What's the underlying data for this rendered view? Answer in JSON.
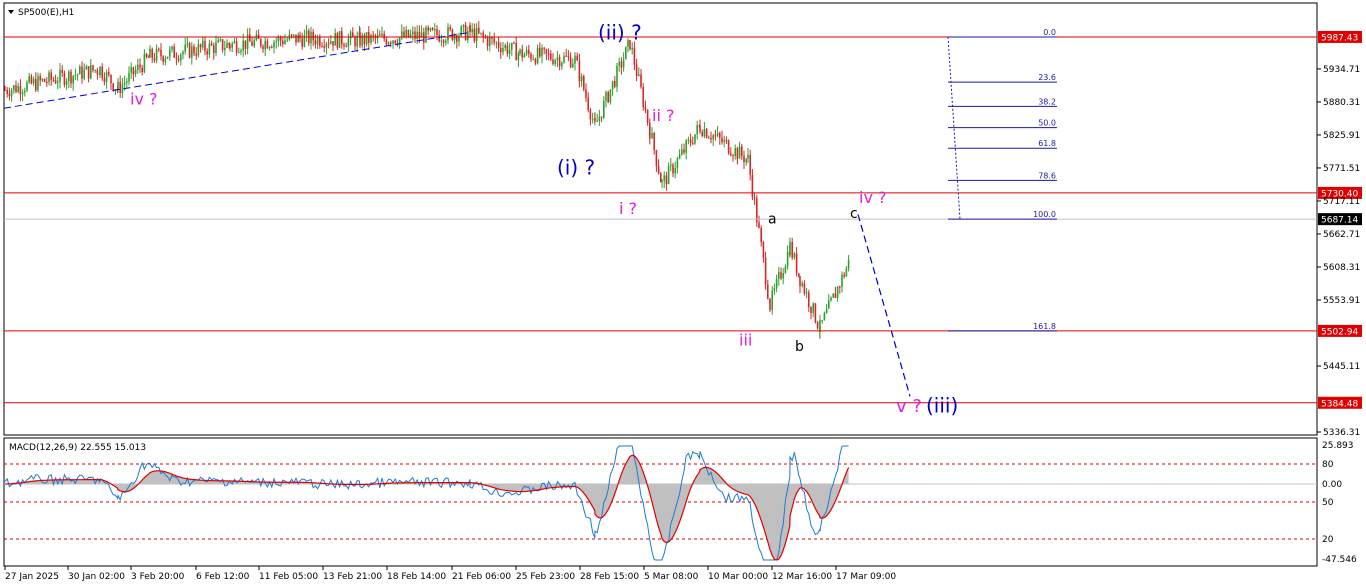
{
  "window": {
    "symbol_label": "SP500(E),H1",
    "symbol_menu_icon": "triangle-down-icon"
  },
  "price_scale": {
    "ticks": [
      "5934.71",
      "5880.31",
      "5825.91",
      "5771.51",
      "5717.11",
      "5662.71",
      "5608.31",
      "5553.91",
      "5445.11",
      "5336.31"
    ],
    "min": 5336.31,
    "max": 5989
  },
  "time_axis": {
    "labels": [
      "27 Jan 2025",
      "30 Jan 02:00",
      "3 Feb 20:00",
      "6 Feb 12:00",
      "11 Feb 05:00",
      "13 Feb 21:00",
      "18 Feb 14:00",
      "21 Feb 06:00",
      "25 Feb 23:00",
      "28 Feb 15:00",
      "5 Mar 08:00",
      "10 Mar 00:00",
      "12 Mar 16:00",
      "17 Mar 09:00"
    ]
  },
  "colors": {
    "bull_candle": "#2ca02c",
    "bear_candle": "#d62728",
    "hline": "#e00000",
    "blue_label": "#0000cc",
    "magenta_label": "#e020e0",
    "black_label": "#000000",
    "fib": "#1a1aa8",
    "macd_hist": "#c0c0c0",
    "macd_signal": "#e00000",
    "macd_line": "#1e7ad6",
    "price_box": "#e00000"
  },
  "chart_data": [
    {
      "type": "candlestick",
      "title": "SP500(E),H1",
      "ylim": [
        5336.31,
        5989
      ],
      "path_points": [
        {
          "x": "27 Jan 2025",
          "y": 5900
        },
        {
          "x": "30 Jan 02:00",
          "y": 5935
        },
        {
          "x": "iv ? low",
          "y": 5902
        },
        {
          "x": "3 Feb 20:00",
          "y": 5955
        },
        {
          "x": "6 Feb 12:00",
          "y": 5975
        },
        {
          "x": "11 Feb 05:00",
          "y": 5985
        },
        {
          "x": "13 Feb 21:00",
          "y": 5982
        },
        {
          "x": "18 Feb 14:00",
          "y": 5995
        },
        {
          "x": "21 Feb 06:00",
          "y": 5960
        },
        {
          "x": "25 Feb 23:00",
          "y": 5950
        },
        {
          "x": "(i) low",
          "y": 5840
        },
        {
          "x": "(ii) high",
          "y": 5978
        },
        {
          "x": "i low",
          "y": 5745
        },
        {
          "x": "ii high",
          "y": 5840
        },
        {
          "x": "5 Mar 08:00",
          "y": 5785
        },
        {
          "x": "iii low",
          "y": 5545
        },
        {
          "x": "a high",
          "y": 5642
        },
        {
          "x": "12 Mar 16:00",
          "y": 5590
        },
        {
          "x": "b low",
          "y": 5507
        },
        {
          "x": "17 Mar 09:00",
          "y": 5620
        },
        {
          "x": "c high",
          "y": 5700
        }
      ],
      "horizontal_levels": [
        {
          "price": 5987.43,
          "label": "5987.43"
        },
        {
          "price": 5730.4,
          "label": "5730.40"
        },
        {
          "price": 5502.94,
          "label": "5502.94"
        },
        {
          "price": 5384.48,
          "label": "5384.48"
        }
      ],
      "current_price": {
        "price": 5687.14,
        "label": "5687.14"
      },
      "fibonacci": [
        {
          "level": "0.0",
          "price": 5987.43
        },
        {
          "level": "23.6",
          "price": 5913
        },
        {
          "level": "38.2",
          "price": 5873
        },
        {
          "level": "50.0",
          "price": 5838
        },
        {
          "level": "61.8",
          "price": 5804
        },
        {
          "level": "78.6",
          "price": 5751
        },
        {
          "level": "100.0",
          "price": 5687.14
        },
        {
          "level": "161.8",
          "price": 5502.94
        }
      ],
      "wave_labels": [
        {
          "text": "iv ?",
          "color": "magenta"
        },
        {
          "text": "(ii) ?",
          "color": "blue"
        },
        {
          "text": "(i) ?",
          "color": "blue"
        },
        {
          "text": "ii ?",
          "color": "magenta"
        },
        {
          "text": "i ?",
          "color": "magenta"
        },
        {
          "text": "a",
          "color": "black"
        },
        {
          "text": "c",
          "color": "black"
        },
        {
          "text": "iv ?",
          "color": "magenta"
        },
        {
          "text": "iii",
          "color": "magenta"
        },
        {
          "text": "b",
          "color": "black"
        },
        {
          "text": "v ?",
          "color": "magenta"
        },
        {
          "text": "(iii)",
          "color": "blue"
        }
      ],
      "projection": {
        "from": "c high",
        "to_price": 5395
      }
    },
    {
      "type": "macd",
      "title": "MACD(12,26,9) 22.555 15.013",
      "ylim": [
        -47.546,
        25.893
      ],
      "ticks": [
        "25.893",
        "80",
        "0.00",
        "50",
        "20",
        "-47.546"
      ],
      "levels": [
        {
          "label": "80"
        },
        {
          "label": "0.00"
        },
        {
          "label": "50"
        },
        {
          "label": "20"
        }
      ]
    }
  ]
}
